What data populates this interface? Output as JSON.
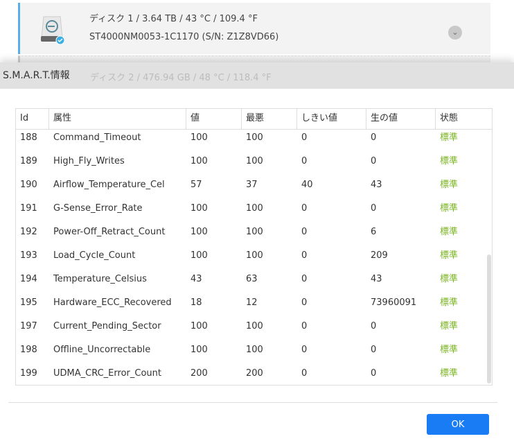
{
  "disks": [
    {
      "title": "ディスク 1 / 3.64 TB / 43 °C / 109.4 °F",
      "model": "ST4000NM0053-1C1170 (S/N: Z1Z8VD66)"
    },
    {
      "title": "ディスク 2 / 476.94 GB / 48 °C / 118.4 °F"
    }
  ],
  "dialog": {
    "title": "S.M.A.R.T.情報",
    "ok_label": "OK"
  },
  "table": {
    "columns": [
      "Id",
      "属性",
      "値",
      "最悪",
      "しきい値",
      "生の値",
      "状態"
    ],
    "rows": [
      [
        "188",
        "Command_Timeout",
        "100",
        "100",
        "0",
        "0",
        "標準"
      ],
      [
        "189",
        "High_Fly_Writes",
        "100",
        "100",
        "0",
        "0",
        "標準"
      ],
      [
        "190",
        "Airflow_Temperature_Cel",
        "57",
        "37",
        "40",
        "43",
        "標準"
      ],
      [
        "191",
        "G-Sense_Error_Rate",
        "100",
        "100",
        "0",
        "0",
        "標準"
      ],
      [
        "192",
        "Power-Off_Retract_Count",
        "100",
        "100",
        "0",
        "6",
        "標準"
      ],
      [
        "193",
        "Load_Cycle_Count",
        "100",
        "100",
        "0",
        "209",
        "標準"
      ],
      [
        "194",
        "Temperature_Celsius",
        "43",
        "63",
        "0",
        "43",
        "標準"
      ],
      [
        "195",
        "Hardware_ECC_Recovered",
        "18",
        "12",
        "0",
        "73960091",
        "標準"
      ],
      [
        "197",
        "Current_Pending_Sector",
        "100",
        "100",
        "0",
        "0",
        "標準"
      ],
      [
        "198",
        "Offline_Uncorrectable",
        "100",
        "100",
        "0",
        "0",
        "標準"
      ],
      [
        "199",
        "UDMA_CRC_Error_Count",
        "200",
        "200",
        "0",
        "0",
        "標準"
      ]
    ]
  },
  "colors": {
    "accent": "#1a7cf5",
    "status_ok": "#7ab521",
    "selected_border": "#5aaee8"
  }
}
